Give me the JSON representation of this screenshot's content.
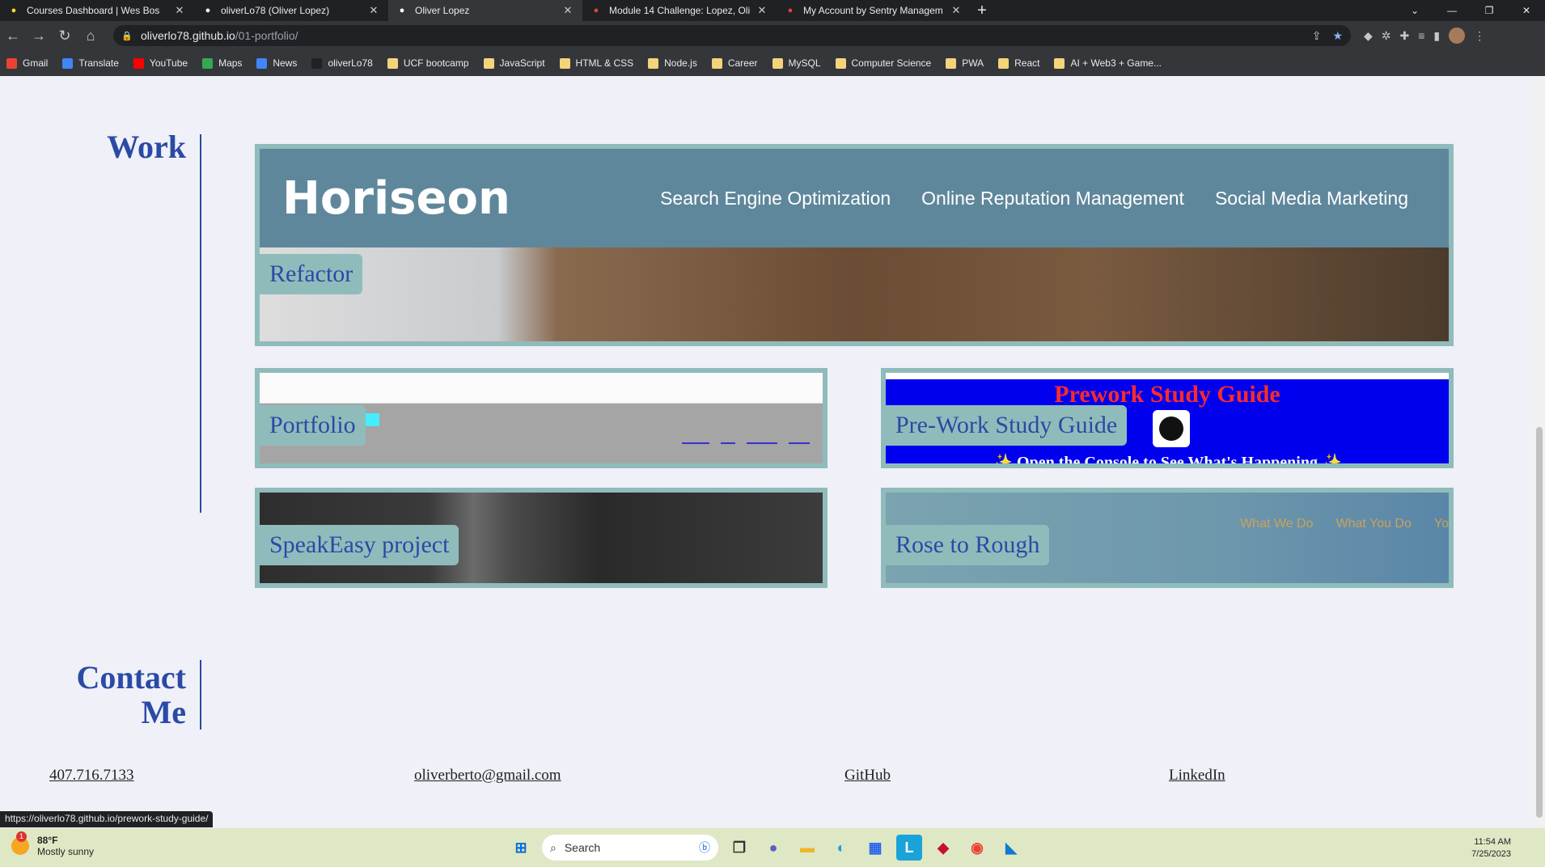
{
  "browser": {
    "tabs": [
      {
        "title": "Courses Dashboard | Wes Bos",
        "active": false,
        "icon": "wes-bos-icon",
        "color": "#f7df1e"
      },
      {
        "title": "oliverLo78 (Oliver Lopez)",
        "active": false,
        "icon": "github-icon",
        "color": "#ffffff"
      },
      {
        "title": "Oliver Lopez",
        "active": true,
        "icon": "globe-icon",
        "color": "#ffffff"
      },
      {
        "title": "Module 14 Challenge: Lopez, Oli",
        "active": false,
        "icon": "canvas-icon",
        "color": "#e0443e"
      },
      {
        "title": "My Account by Sentry Managem",
        "active": false,
        "icon": "sentry-icon",
        "color": "#e0443e"
      }
    ],
    "url_host": "oliverlo78.github.io",
    "url_path": "/01-portfolio/",
    "bookmarks": [
      {
        "label": "Gmail",
        "icon": "gmail-icon",
        "color": "#ea4335"
      },
      {
        "label": "Translate",
        "icon": "translate-icon",
        "color": "#4285f4"
      },
      {
        "label": "YouTube",
        "icon": "youtube-icon",
        "color": "#ff0000"
      },
      {
        "label": "Maps",
        "icon": "maps-icon",
        "color": "#34a853"
      },
      {
        "label": "News",
        "icon": "news-icon",
        "color": "#4285f4"
      },
      {
        "label": "oliverLo78",
        "icon": "github-icon",
        "color": "#202124"
      },
      {
        "label": "UCF bootcamp",
        "icon": "folder-icon",
        "color": "#f4d47a"
      },
      {
        "label": "JavaScript",
        "icon": "folder-icon",
        "color": "#f4d47a"
      },
      {
        "label": "HTML & CSS",
        "icon": "folder-icon",
        "color": "#f4d47a"
      },
      {
        "label": "Node.js",
        "icon": "folder-icon",
        "color": "#f4d47a"
      },
      {
        "label": "Career",
        "icon": "folder-icon",
        "color": "#f4d47a"
      },
      {
        "label": "MySQL",
        "icon": "folder-icon",
        "color": "#f4d47a"
      },
      {
        "label": "Computer Science",
        "icon": "folder-icon",
        "color": "#f4d47a"
      },
      {
        "label": "PWA",
        "icon": "folder-icon",
        "color": "#f4d47a"
      },
      {
        "label": "React",
        "icon": "folder-icon",
        "color": "#f4d47a"
      },
      {
        "label": "AI + Web3 + Game...",
        "icon": "folder-icon",
        "color": "#f4d47a"
      }
    ]
  },
  "page": {
    "work_heading": "Work",
    "contact_heading_line1": "Contact",
    "contact_heading_line2": "Me",
    "projects": {
      "refactor": {
        "label": "Refactor",
        "logo": "Horiseon",
        "nav": [
          "Search Engine Optimization",
          "Online Reputation Management",
          "Social Media Marketing"
        ]
      },
      "portfolio": {
        "label": "Portfolio"
      },
      "prework": {
        "label": "Pre-Work Study Guide",
        "title": "Prework Study Guide",
        "subtitle": "✨ Open the Console to See What's Happening ✨"
      },
      "speakeasy": {
        "label": "SpeakEasy project"
      },
      "rose": {
        "label": "Rose to Rough",
        "nav": [
          "What We Do",
          "What You Do",
          "Yo"
        ]
      }
    },
    "contact": {
      "phone": "407.716.7133",
      "email": "oliverberto@gmail.com",
      "github": "GitHub",
      "linkedin": "LinkedIn"
    },
    "status_url": "https://oliverlo78.github.io/prework-study-guide/"
  },
  "taskbar": {
    "temperature": "88°F",
    "weather": "Mostly sunny",
    "weather_badge": "1",
    "search_placeholder": "Search",
    "time": "11:54 AM",
    "date": "7/25/2023"
  },
  "colors": {
    "heading": "#2a4aa5",
    "card_border": "#8fbcbb",
    "background": "#eff0f8"
  }
}
